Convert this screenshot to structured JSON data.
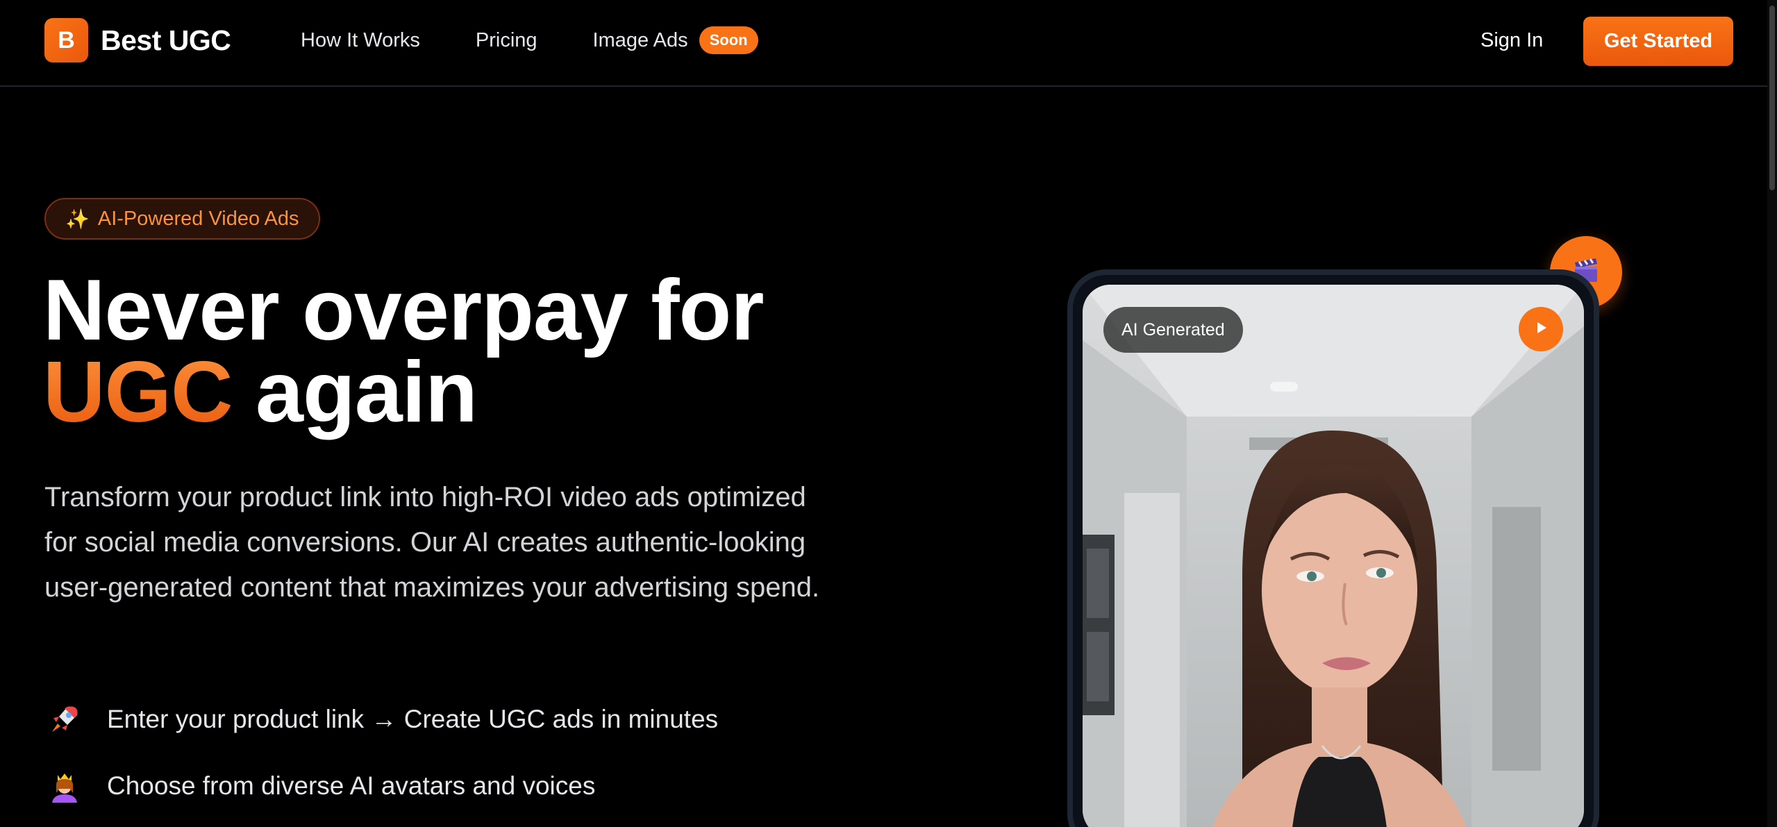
{
  "brand": {
    "logo_letter": "B",
    "name": "Best UGC"
  },
  "nav": {
    "links": [
      "How It Works",
      "Pricing",
      "Image Ads"
    ],
    "soon_badge": "Soon",
    "sign_in": "Sign In",
    "get_started": "Get Started"
  },
  "hero": {
    "tag": "AI-Powered Video Ads",
    "headline_line1": "Never overpay for",
    "headline_accent": "UGC",
    "headline_line2_rest": "again",
    "subtext": "Transform your product link into high-ROI video ads optimized for social media conversions. Our AI creates authentic-looking user-generated content that maximizes your advertising spend.",
    "features": [
      {
        "icon": "rocket-icon",
        "text": "Enter your product link → Create UGC ads in minutes"
      },
      {
        "icon": "avatar-icon",
        "text": "Choose from diverse AI avatars and voices"
      }
    ]
  },
  "video_card": {
    "badge": "AI Generated",
    "float_icon": "clapperboard-icon",
    "play_icon": "play-icon"
  },
  "colors": {
    "accent": "#f97316",
    "background": "#000000",
    "text": "#ffffff"
  }
}
